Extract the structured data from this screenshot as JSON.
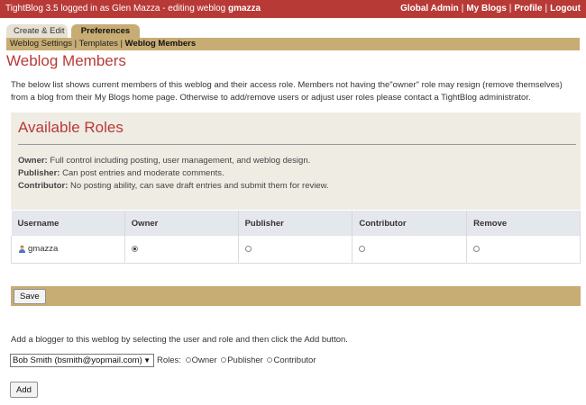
{
  "topbar": {
    "status_prefix": "TightBlog 3.5 logged in as Glen Mazza - editing weblog",
    "weblog": "gmazza",
    "links": [
      "Global Admin",
      "My Blogs",
      "Profile",
      "Logout"
    ],
    "separator": "|"
  },
  "tabs": [
    {
      "label": "Create & Edit",
      "active": false
    },
    {
      "label": "Preferences",
      "active": true
    }
  ],
  "subnav": {
    "items": [
      "Weblog Settings",
      "Templates",
      "Weblog Members"
    ],
    "separator": "|",
    "current": "Weblog Members"
  },
  "page": {
    "title": "Weblog Members",
    "intro": "The below list shows current members of this weblog and their access role. Members not having the\"owner\" role may resign (remove themselves) from a blog from their My Blogs home page. Otherwise to add/remove users or adjust user roles please contact a TightBlog administrator."
  },
  "roles": {
    "title": "Available Roles",
    "items": [
      {
        "name": "Owner:",
        "desc": "Full control including posting, user management, and weblog design."
      },
      {
        "name": "Publisher:",
        "desc": "Can post entries and moderate comments."
      },
      {
        "name": "Contributor:",
        "desc": "No posting ability, can save draft entries and submit them for review."
      }
    ]
  },
  "table": {
    "headers": [
      "Username",
      "Owner",
      "Publisher",
      "Contributor",
      "Remove"
    ],
    "rows": [
      {
        "username": "gmazza",
        "selected_role": "Owner"
      }
    ]
  },
  "save": {
    "label": "Save"
  },
  "add_section": {
    "instructions": "Add a blogger to this weblog by selecting the user and role and then click the Add button.",
    "user_select_value": "Bob Smith (bsmith@yopmail.com)",
    "roles_label": "Roles:",
    "role_options": [
      "Owner",
      "Publisher",
      "Contributor"
    ],
    "add_label": "Add"
  },
  "colors": {
    "topbar": "#b83a37",
    "accent_tan": "#c7ad74",
    "title_red": "#b83a37"
  }
}
